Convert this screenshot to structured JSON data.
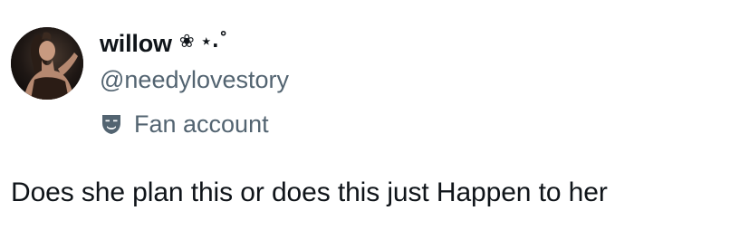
{
  "author": {
    "display_name": "willow",
    "name_decoration": "❀ ⋆.˚",
    "handle": "@needylovestory",
    "avatar_icon": "avatar-photo"
  },
  "label": {
    "icon": "theater-masks-icon",
    "text": "Fan account"
  },
  "tweet": {
    "text": "Does she plan this or does this just Happen to her"
  },
  "colors": {
    "primary_text": "#0f1419",
    "secondary_text": "#536471",
    "background": "#ffffff"
  }
}
